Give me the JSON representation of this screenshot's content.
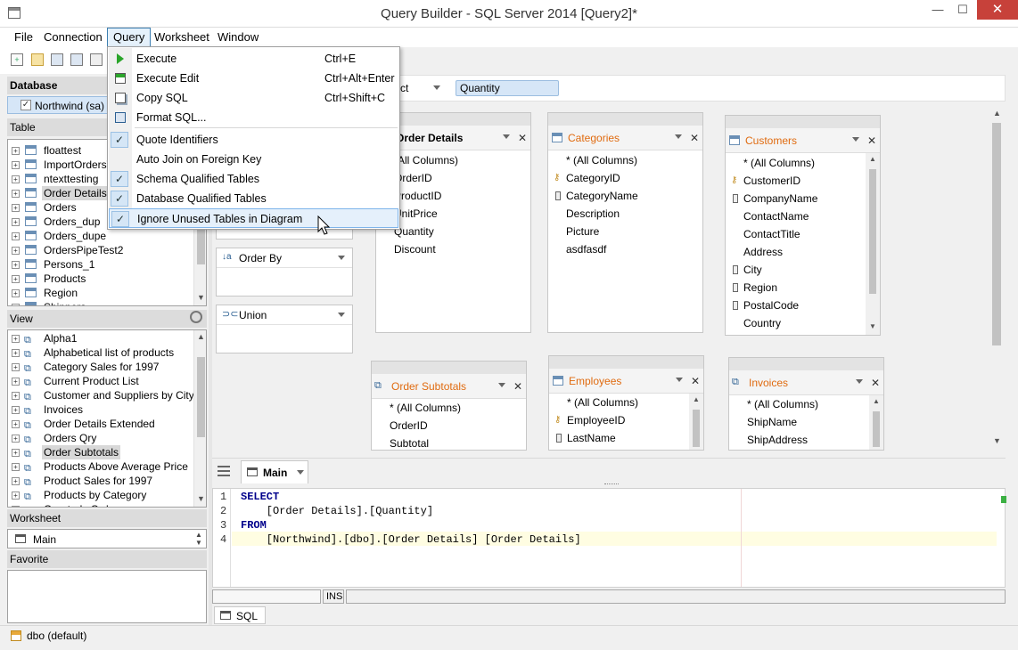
{
  "window": {
    "title": "Query Builder - SQL Server 2014 [Query2]*",
    "minimize": "—",
    "maximize": "☐",
    "close": "✕"
  },
  "menu": {
    "items": [
      "File",
      "Connection",
      "Query",
      "Worksheet",
      "Window"
    ]
  },
  "database": {
    "header": "Database",
    "selected": "Northwind (sa)"
  },
  "table_panel": {
    "header": "Table",
    "items": [
      "floattest",
      "ImportOrdersT",
      "ntexttesting",
      "Order Details",
      "Orders",
      "Orders_dup",
      "Orders_dupe",
      "OrdersPipeTest2",
      "Persons_1",
      "Products",
      "Region",
      "Shippers"
    ]
  },
  "view_panel": {
    "header": "View",
    "items": [
      "Alpha1",
      "Alphabetical list of products",
      "Category Sales for 1997",
      "Current Product List",
      "Customer and Suppliers by City",
      "Invoices",
      "Order Details Extended",
      "Orders Qry",
      "Order Subtotals",
      "Products Above Average Price",
      "Product Sales for 1997",
      "Products by Category",
      "Quarterly Orders"
    ]
  },
  "worksheet_panel": {
    "header": "Worksheet",
    "value": "Main"
  },
  "favorite_panel": {
    "header": "Favorite"
  },
  "query_menu": {
    "items": [
      {
        "label": "Execute",
        "shortcut": "Ctrl+E"
      },
      {
        "label": "Execute Edit",
        "shortcut": "Ctrl+Alt+Enter"
      },
      {
        "label": "Copy SQL",
        "shortcut": "Ctrl+Shift+C"
      },
      {
        "label": "Format SQL...",
        "shortcut": ""
      },
      {
        "label": "Quote Identifiers",
        "checked": true
      },
      {
        "label": "Auto Join on Foreign Key",
        "checked": false
      },
      {
        "label": "Schema Qualified Tables",
        "checked": true
      },
      {
        "label": "Database Qualified Tables",
        "checked": true
      },
      {
        "label": "Ignore Unused Tables in Diagram",
        "checked": true
      }
    ]
  },
  "filter_bar": {
    "partial": "ct",
    "field": "Quantity"
  },
  "side_cards": {
    "order_by": "Order By",
    "union": "Union"
  },
  "diagram": {
    "order_details": {
      "title": "Order Details",
      "columns": [
        "(All Columns)",
        "OrderID",
        "ProductID",
        "UnitPrice",
        "Quantity",
        "Discount"
      ]
    },
    "categories": {
      "title": "Categories",
      "columns": [
        "* (All Columns)",
        "CategoryID",
        "CategoryName",
        "Description",
        "Picture",
        "asdfasdf"
      ]
    },
    "customers": {
      "title": "Customers",
      "columns": [
        "* (All Columns)",
        "CustomerID",
        "CompanyName",
        "ContactName",
        "ContactTitle",
        "Address",
        "City",
        "Region",
        "PostalCode",
        "Country"
      ]
    },
    "order_subtotals": {
      "title": "Order Subtotals",
      "columns": [
        "* (All Columns)",
        "OrderID",
        "Subtotal"
      ]
    },
    "employees": {
      "title": "Employees",
      "columns": [
        "* (All Columns)",
        "EmployeeID",
        "LastName"
      ]
    },
    "invoices": {
      "title": "Invoices",
      "columns": [
        "* (All Columns)",
        "ShipName",
        "ShipAddress"
      ]
    }
  },
  "editor": {
    "tab": "Main",
    "lines": [
      {
        "no": "1",
        "text": "SELECT"
      },
      {
        "no": "2",
        "text": "    [Order Details].[Quantity]"
      },
      {
        "no": "3",
        "text": "FROM"
      },
      {
        "no": "4",
        "text": "    [Northwind].[dbo].[Order Details] [Order Details]"
      }
    ],
    "ins": "INS",
    "sql_tab": "SQL"
  },
  "status": {
    "schema": "dbo (default)"
  }
}
